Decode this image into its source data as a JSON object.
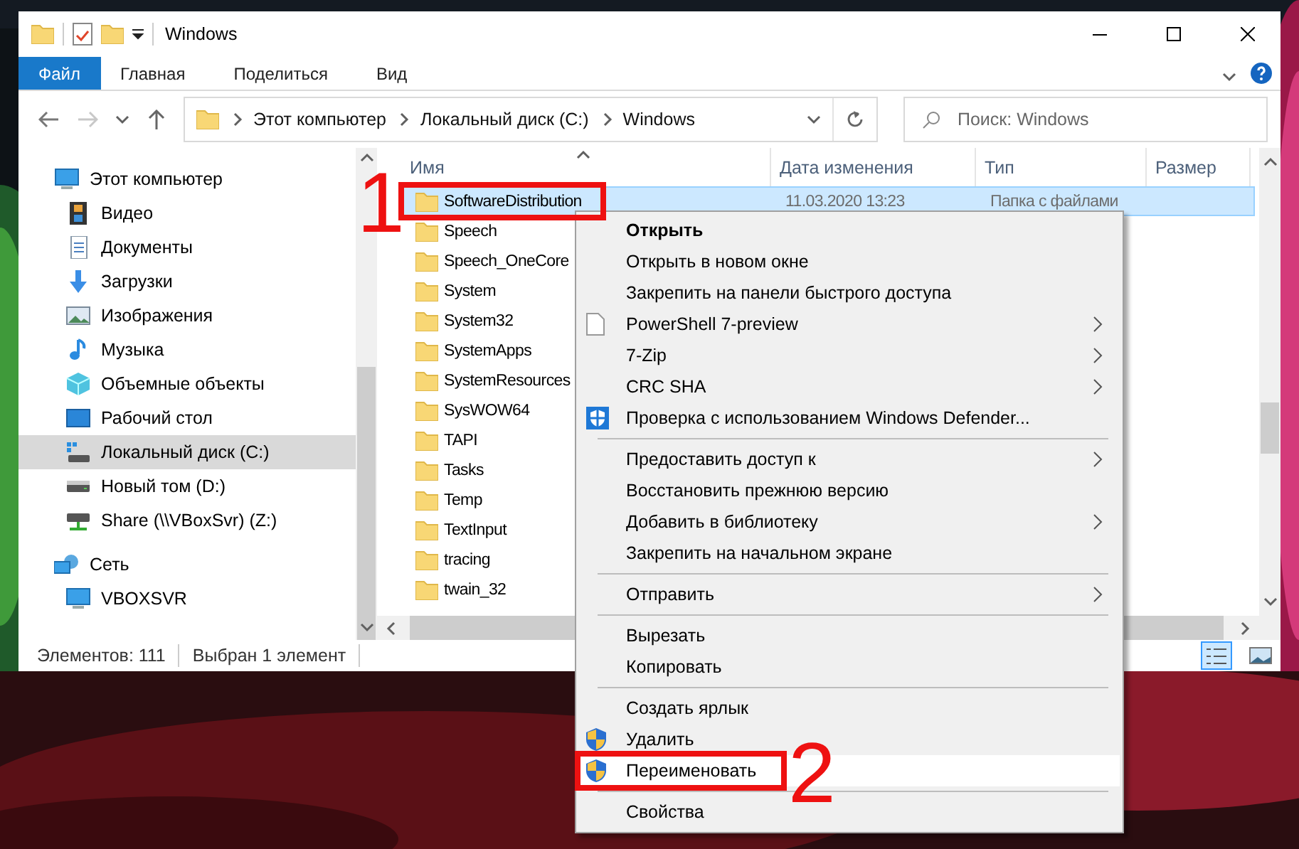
{
  "window": {
    "title": "Windows"
  },
  "ribbon_tabs": [
    {
      "label": "Файл",
      "selected": true
    },
    {
      "label": "Главная",
      "selected": false
    },
    {
      "label": "Поделиться",
      "selected": false
    },
    {
      "label": "Вид",
      "selected": false
    }
  ],
  "address_bar": {
    "path": [
      "Этот компьютер",
      "Локальный диск (C:)",
      "Windows"
    ]
  },
  "search": {
    "placeholder": "Поиск: Windows"
  },
  "navigation": [
    {
      "label": "Этот компьютер",
      "selected": false,
      "children": [
        {
          "label": "Видео",
          "selected": false
        },
        {
          "label": "Документы",
          "selected": false
        },
        {
          "label": "Загрузки",
          "selected": false
        },
        {
          "label": "Изображения",
          "selected": false
        },
        {
          "label": "Музыка",
          "selected": false
        },
        {
          "label": "Объемные объекты",
          "selected": false
        },
        {
          "label": "Рабочий стол",
          "selected": false
        },
        {
          "label": "Локальный диск (C:)",
          "selected": true
        },
        {
          "label": "Новый том (D:)",
          "selected": false
        },
        {
          "label": "Share (\\\\VBoxSvr) (Z:)",
          "selected": false
        }
      ]
    },
    {
      "label": "Сеть",
      "selected": false,
      "children": [
        {
          "label": "VBOXSVR",
          "selected": false
        }
      ]
    }
  ],
  "file_list": {
    "columns": [
      "Имя",
      "Дата изменения",
      "Тип",
      "Размер"
    ],
    "rows": [
      {
        "name": "SoftwareDistribution",
        "modified": "11.03.2020 13:23",
        "type": "Папка с файлами",
        "selected": true
      },
      {
        "name": "Speech",
        "selected": false
      },
      {
        "name": "Speech_OneCore",
        "selected": false
      },
      {
        "name": "System",
        "selected": false
      },
      {
        "name": "System32",
        "selected": false
      },
      {
        "name": "SystemApps",
        "selected": false
      },
      {
        "name": "SystemResources",
        "selected": false
      },
      {
        "name": "SysWOW64",
        "selected": false
      },
      {
        "name": "TAPI",
        "selected": false
      },
      {
        "name": "Tasks",
        "selected": false
      },
      {
        "name": "Temp",
        "selected": false
      },
      {
        "name": "TextInput",
        "selected": false
      },
      {
        "name": "tracing",
        "selected": false
      },
      {
        "name": "twain_32",
        "selected": false
      }
    ]
  },
  "status_bar": {
    "item_count": "Элементов: 111",
    "selection": "Выбран 1 элемент"
  },
  "view_buttons": [
    {
      "selected": true
    },
    {
      "selected": false
    }
  ],
  "context_menu": {
    "items": [
      {
        "kind": "item",
        "label": "Открыть",
        "default": true,
        "submenu": false,
        "selected": false
      },
      {
        "kind": "item",
        "label": "Открыть в новом окне",
        "default": false,
        "submenu": false,
        "selected": false
      },
      {
        "kind": "item",
        "label": "Закрепить на панели быстрого доступа",
        "default": false,
        "submenu": false,
        "selected": false
      },
      {
        "kind": "item",
        "label": "PowerShell 7-preview",
        "default": false,
        "submenu": true,
        "selected": false
      },
      {
        "kind": "item",
        "label": "7-Zip",
        "default": false,
        "submenu": true,
        "selected": false
      },
      {
        "kind": "item",
        "label": "CRC SHA",
        "default": false,
        "submenu": true,
        "selected": false
      },
      {
        "kind": "item",
        "label": "Проверка с использованием Windows Defender...",
        "default": false,
        "submenu": false,
        "selected": false
      },
      {
        "kind": "separator"
      },
      {
        "kind": "item",
        "label": "Предоставить доступ к",
        "default": false,
        "submenu": true,
        "selected": false
      },
      {
        "kind": "item",
        "label": "Восстановить прежнюю версию",
        "default": false,
        "submenu": false,
        "selected": false
      },
      {
        "kind": "item",
        "label": "Добавить в библиотеку",
        "default": false,
        "submenu": true,
        "selected": false
      },
      {
        "kind": "item",
        "label": "Закрепить на начальном экране",
        "default": false,
        "submenu": false,
        "selected": false
      },
      {
        "kind": "separator"
      },
      {
        "kind": "item",
        "label": "Отправить",
        "default": false,
        "submenu": true,
        "selected": false
      },
      {
        "kind": "separator"
      },
      {
        "kind": "item",
        "label": "Вырезать",
        "default": false,
        "submenu": false,
        "selected": false
      },
      {
        "kind": "item",
        "label": "Копировать",
        "default": false,
        "submenu": false,
        "selected": false
      },
      {
        "kind": "separator"
      },
      {
        "kind": "item",
        "label": "Создать ярлык",
        "default": false,
        "submenu": false,
        "selected": false
      },
      {
        "kind": "item",
        "label": "Удалить",
        "default": false,
        "submenu": false,
        "selected": false
      },
      {
        "kind": "item",
        "label": "Переименовать",
        "default": false,
        "submenu": false,
        "selected": true
      },
      {
        "kind": "separator"
      },
      {
        "kind": "item",
        "label": "Свойства",
        "default": false,
        "submenu": false,
        "selected": false
      }
    ]
  },
  "annotations": [
    {
      "label": "1"
    },
    {
      "label": "2"
    }
  ]
}
